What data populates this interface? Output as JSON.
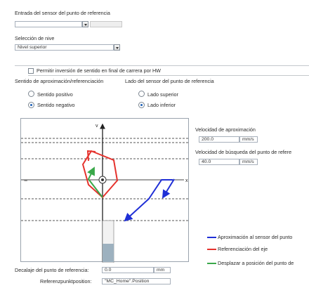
{
  "reference_input": {
    "label": "Entrada del sensor del punto de referencia",
    "value": ""
  },
  "side_selection": {
    "label": "Selección de nive",
    "value": "Nivel superior"
  },
  "reverse_option": {
    "label": "Permitir inversión de sentido en final de carrera por HW",
    "checked": false
  },
  "approach_direction": {
    "label": "Sentido de aproximación/referenciación",
    "options": [
      {
        "label": "Sentido positivo",
        "selected": false
      },
      {
        "label": "Sentido negativo",
        "selected": true
      }
    ]
  },
  "sensor_side": {
    "label": "Lado del sensor del punto de referencia",
    "options": [
      {
        "label": "Lado superior",
        "selected": false
      },
      {
        "label": "Lado inferior",
        "selected": true
      }
    ]
  },
  "approach_velocity": {
    "label": "Velocidad de aproximación",
    "value": "200.0",
    "unit": "mm/s"
  },
  "search_velocity": {
    "label": "Velocidad de búsqueda del punto de refere",
    "value": "40.0",
    "unit": "mm/s"
  },
  "legend": [
    {
      "label": "Aproximación al sensor del punto",
      "color": "#1f2fd6"
    },
    {
      "label": "Referenciación del eje",
      "color": "#e5322d"
    },
    {
      "label": "Desplazar a posición del punto de",
      "color": "#3aa84a"
    }
  ],
  "diagram": {
    "axis_y_label": "v",
    "axis_x_label": "x",
    "minus_label": "−"
  },
  "offset": {
    "label": "Decalaje del punto de referencia:",
    "value": "0.0",
    "unit": "mm"
  },
  "reference_position": {
    "label": "Referenzpunktposition:",
    "value": "\"MC_Home\".Position"
  }
}
